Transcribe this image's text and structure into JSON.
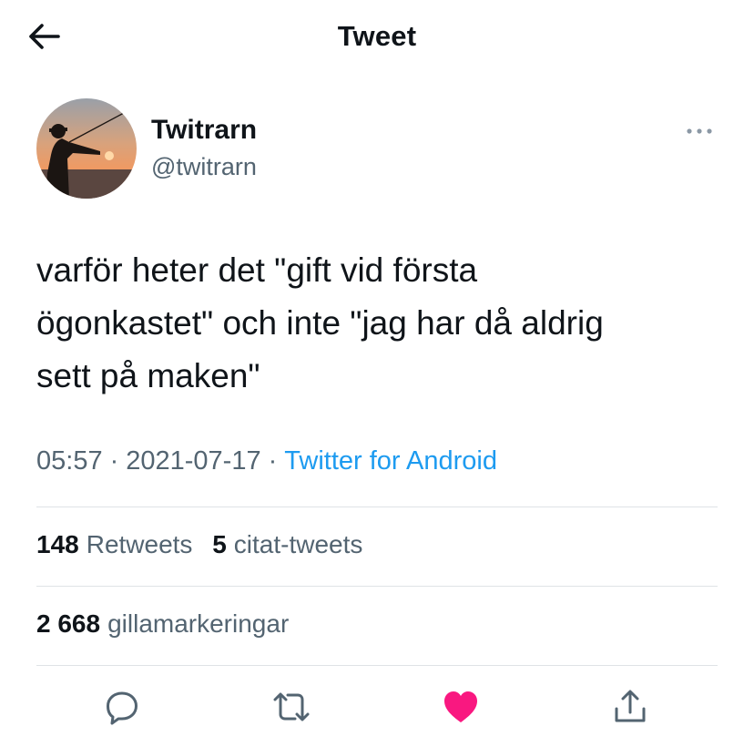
{
  "header": {
    "title": "Tweet",
    "back_icon": "arrow-left-icon"
  },
  "author": {
    "name": "Twitrarn",
    "handle": "@twitrarn",
    "avatar": "fishing-silhouette-sunset"
  },
  "tweet": {
    "lines": [
      "varför heter det \"gift vid första",
      "ögonkastet\" och inte \"jag har då aldrig",
      "sett på maken\""
    ],
    "time": "05:57",
    "separator": "·",
    "date": "2021-07-17",
    "source": "Twitter for Android"
  },
  "stats": {
    "retweets_count": "148",
    "retweets_label": "Retweets",
    "quotes_count": "5",
    "quotes_label": "citat-tweets",
    "likes_count": "2 668",
    "likes_label": "gillamarkeringar"
  },
  "actions": {
    "reply_icon": "reply-icon",
    "retweet_icon": "retweet-icon",
    "like_icon": "heart-filled-icon",
    "share_icon": "share-icon"
  },
  "colors": {
    "text": "#0f1419",
    "secondary": "#536471",
    "link": "#1d9bf0",
    "like": "#f91880",
    "divider": "#dfe3e6"
  }
}
